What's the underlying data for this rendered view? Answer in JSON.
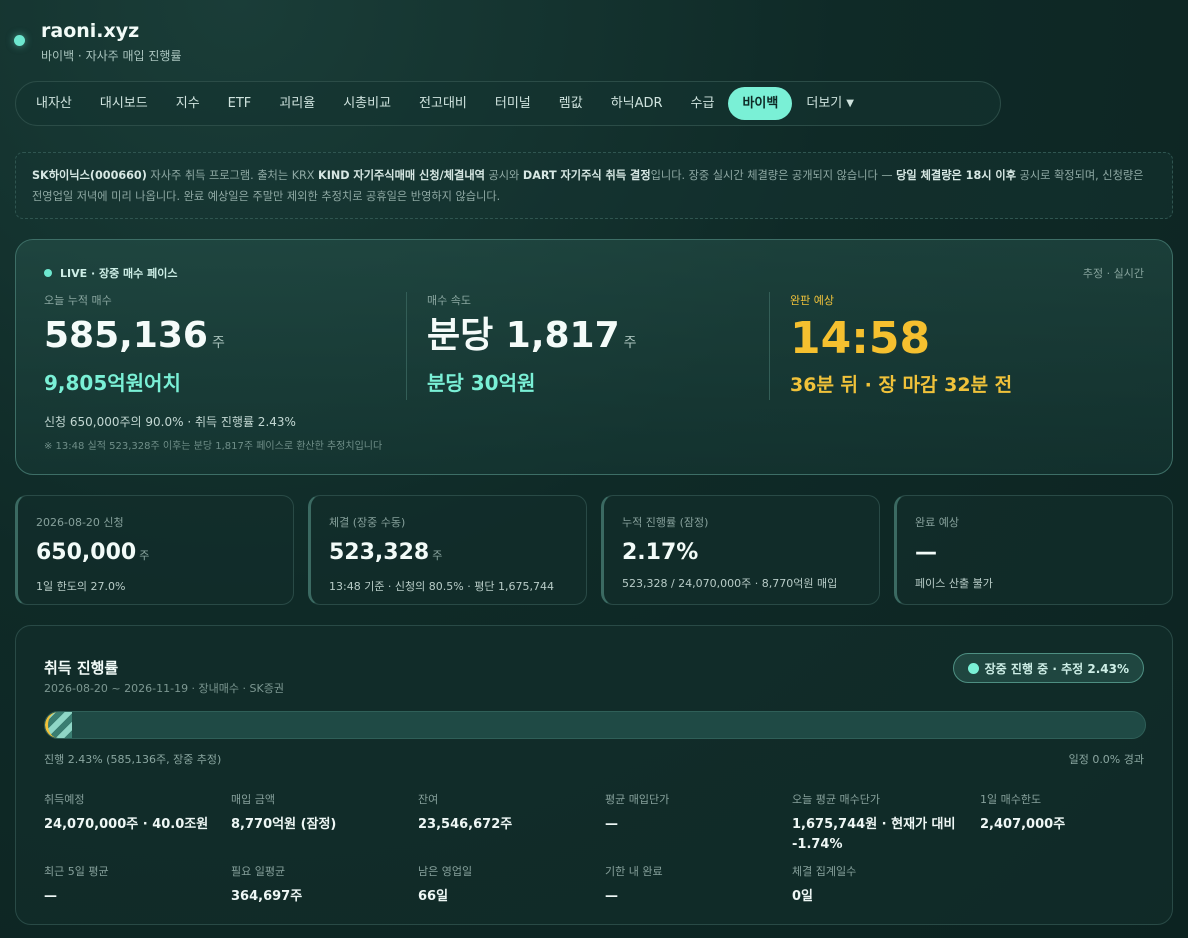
{
  "header": {
    "title": "raoni.xyz",
    "subtitle": "바이백 · 자사주 매입 진행률"
  },
  "nav": {
    "tabs": [
      "내자산",
      "대시보드",
      "지수",
      "ETF",
      "괴리율",
      "시총비교",
      "전고대비",
      "터미널",
      "렘값",
      "하닉ADR",
      "수급",
      "바이백"
    ],
    "active": "바이백",
    "more_label": "더보기"
  },
  "notice": {
    "p1_bold": "SK하이닉스(000660)",
    "p1": " 자사주 취득 프로그램. 출처는 KRX ",
    "p2_bold": "KIND 자기주식매매 신청/체결내역",
    "p2": " 공시와 ",
    "p3_bold": "DART 자기주식 취득 결정",
    "p3": "입니다. 장중 실시간 체결량은 공개되지 않습니다 — ",
    "p4_bold": "당일 체결량은 18시 이후",
    "p4": " 공시로 확정되며, 신청량은 전영업일 저녁에 미리 나옵니다. 완료 예상일은 주말만 제외한 추정치로 공휴일은 반영하지 않습니다."
  },
  "live": {
    "badge": "LIVE · 장중 매수 페이스",
    "est": "추정 · 실시간",
    "today_label": "오늘 누적 매수",
    "today_value": "585,136",
    "today_unit": "주",
    "today_amount": "9,805억원어치",
    "speed_label": "매수 속도",
    "speed_value": "분당 1,817",
    "speed_unit": "주",
    "speed_amount": "분당 30억원",
    "done_label": "완판 예상",
    "done_time": "14:58",
    "done_sub": "36분 뒤 · 장 마감 32분 전",
    "foot1": "신청 650,000주의 90.0% · 취득 진행률 2.43%",
    "foot2": "※ 13:48 실적 523,328주 이후는 분당 1,817주 페이스로 환산한 추정치입니다"
  },
  "cards": [
    {
      "label": "2026-08-20 신청",
      "value": "650,000",
      "unit": "주",
      "sub": "1일 한도의 27.0%"
    },
    {
      "label": "체결 (장중 수동)",
      "value": "523,328",
      "unit": "주",
      "sub": "13:48 기준 · 신청의 80.5% · 평단 1,675,744"
    },
    {
      "label": "누적 진행률 (잠정)",
      "value": "2.17%",
      "unit": "",
      "sub": "523,328 / 24,070,000주 · 8,770억원 매입"
    },
    {
      "label": "완료 예상",
      "value": "—",
      "unit": "",
      "sub": "페이스 산출 불가"
    }
  ],
  "progress": {
    "title": "취득 진행률",
    "subtitle": "2026-08-20 ~ 2026-11-19 · 장내매수 · SK증권",
    "pill": "장중 진행 중 · 추정 2.43%",
    "fill_percent": 2.43,
    "left_caption": "진행 2.43% (585,136주, 장중 추정)",
    "right_caption": "일정 0.0% 경과",
    "stats": [
      {
        "label": "취득예정",
        "value": "24,070,000주 · 40.0조원"
      },
      {
        "label": "매입 금액",
        "value": "8,770억원 (잠정)"
      },
      {
        "label": "잔여",
        "value": "23,546,672주"
      },
      {
        "label": "평균 매입단가",
        "value": "—"
      },
      {
        "label": "오늘 평균 매수단가",
        "value": "1,675,744원 · 현재가 대비 -1.74%"
      },
      {
        "label": "1일 매수한도",
        "value": "2,407,000주"
      },
      {
        "label": "최근 5일 평균",
        "value": "—"
      },
      {
        "label": "필요 일평균",
        "value": "364,697주"
      },
      {
        "label": "남은 영업일",
        "value": "66일"
      },
      {
        "label": "기한 내 완료",
        "value": "—"
      },
      {
        "label": "체결 집계일수",
        "value": "0일"
      }
    ]
  }
}
